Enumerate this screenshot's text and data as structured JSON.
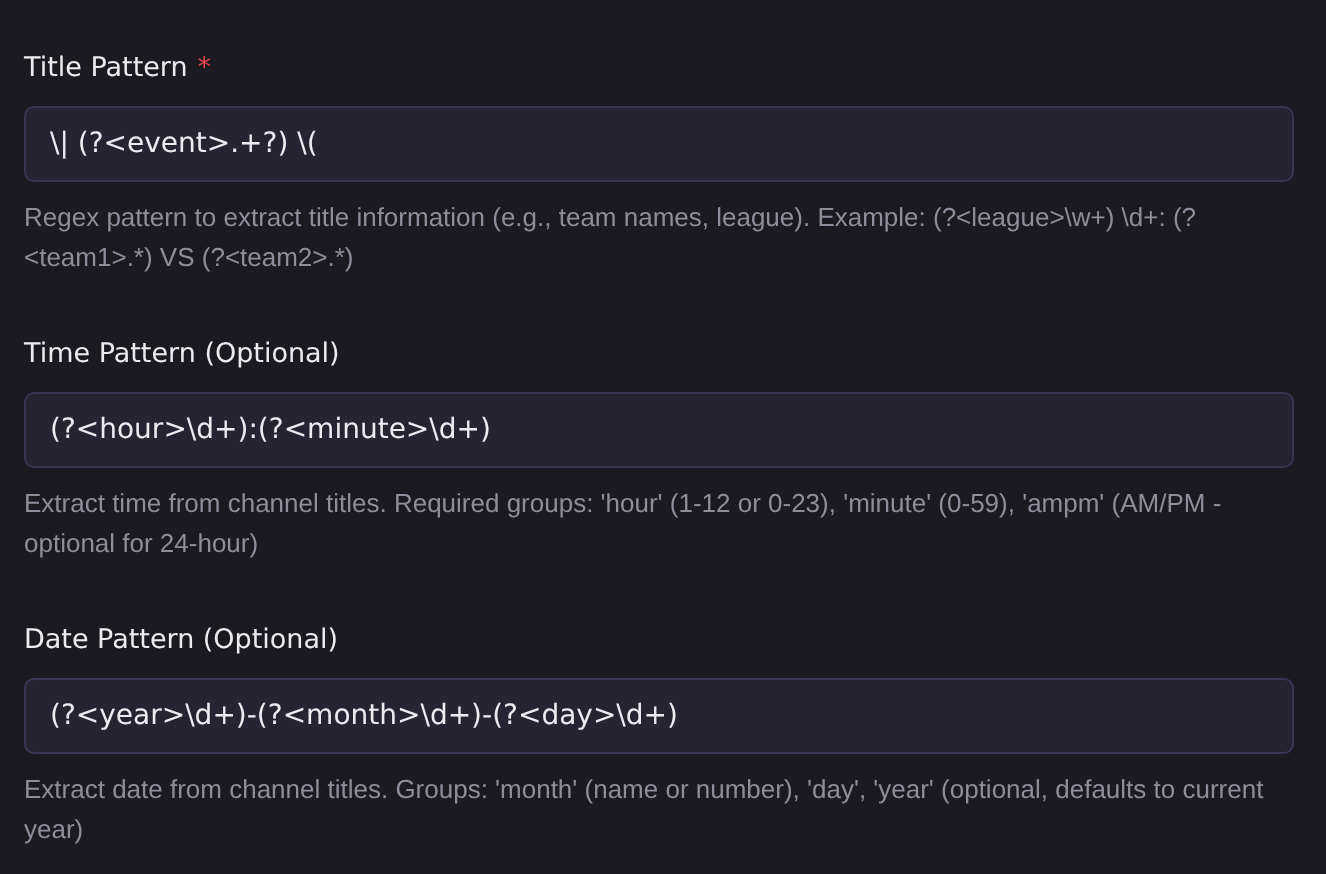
{
  "fields": [
    {
      "label": "Title Pattern",
      "required_mark": "*",
      "value": "\\| (?<event>.+?) \\(",
      "help": "Regex pattern to extract title information (e.g., team names, league). Example: (?<league>\\w+) \\d+: (?<team1>.*) VS (?<team2>.*)"
    },
    {
      "label": "Time Pattern (Optional)",
      "value": "(?<hour>\\d+):(?<minute>\\d+)",
      "help": "Extract time from channel titles. Required groups: 'hour' (1-12 or 0-23), 'minute' (0-59), 'ampm' (AM/PM - optional for 24-hour)"
    },
    {
      "label": "Date Pattern (Optional)",
      "value": "(?<year>\\d+)-(?<month>\\d+)-(?<day>\\d+)",
      "help": "Extract date from channel titles. Groups: 'month' (name or number), 'day', 'year' (optional, defaults to current year)"
    }
  ]
}
